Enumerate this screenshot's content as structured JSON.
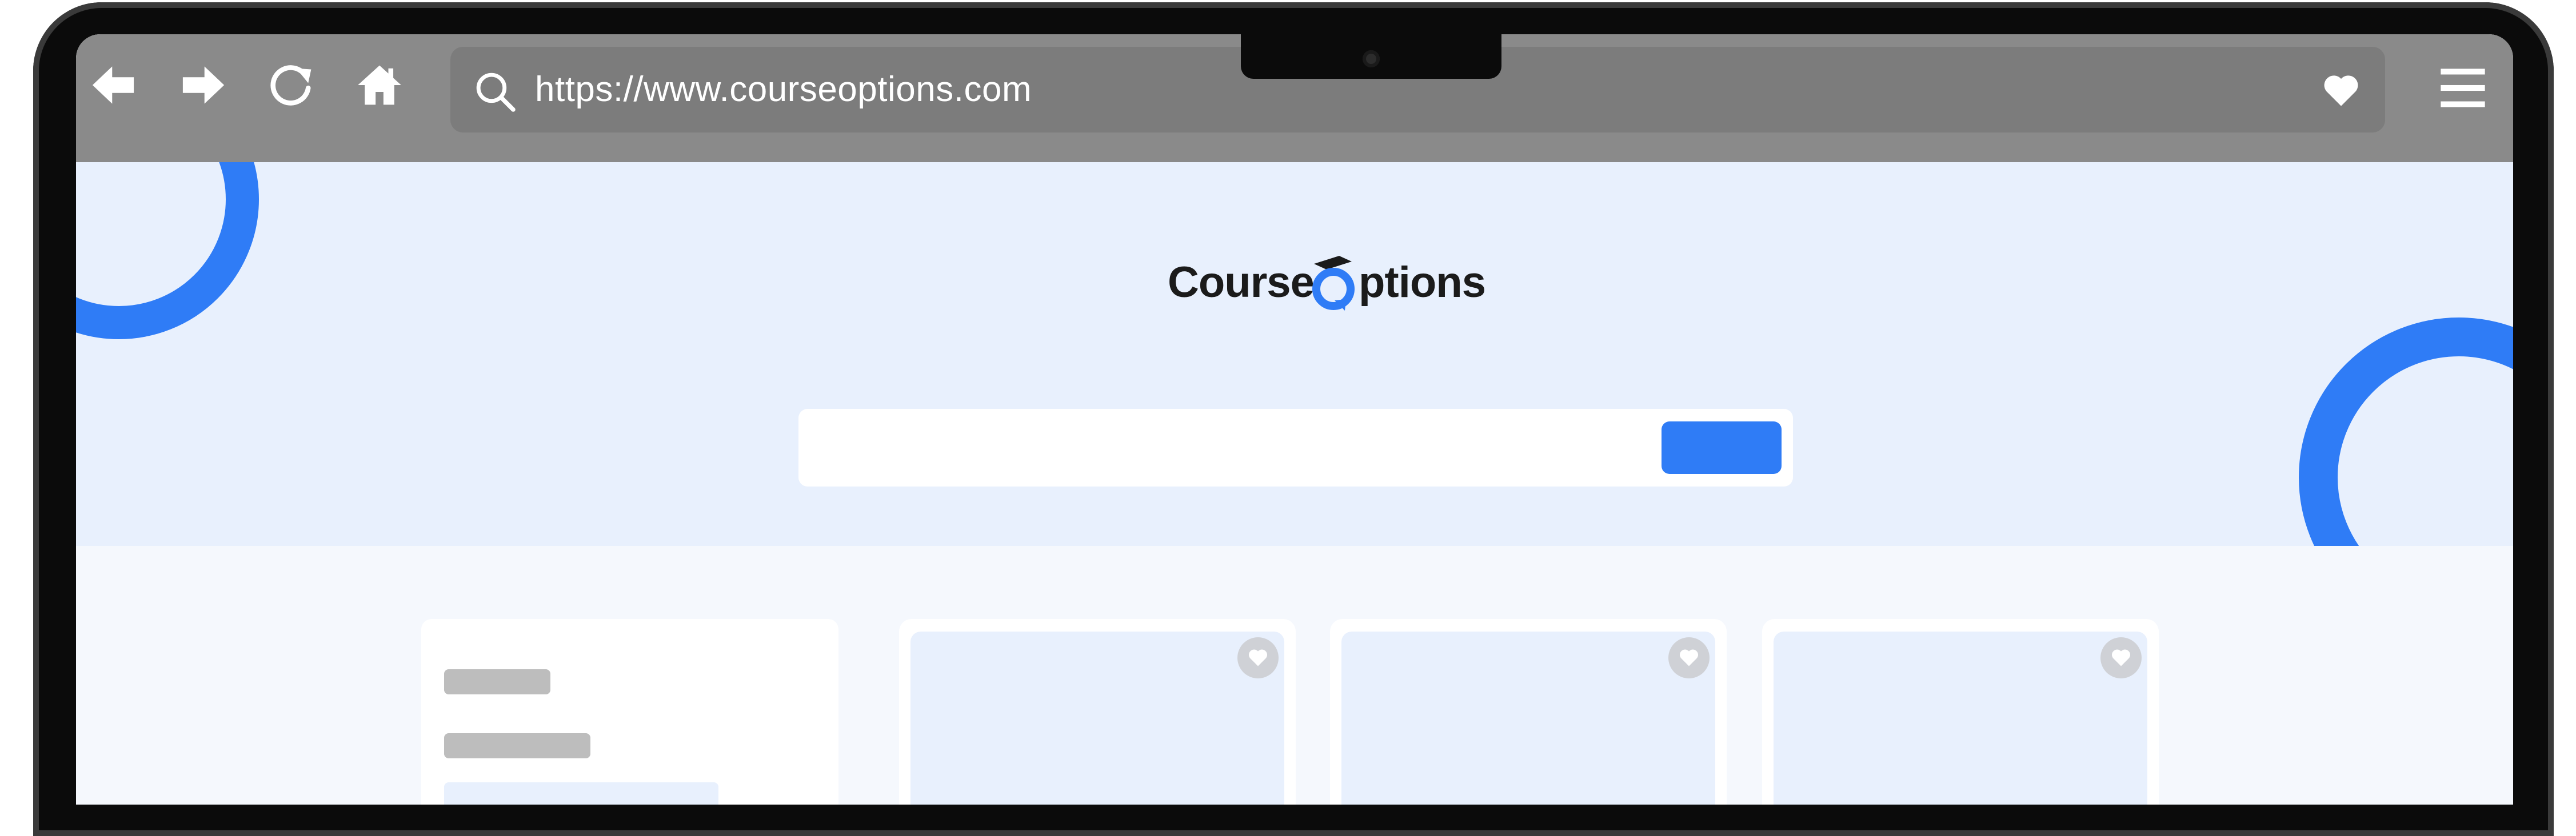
{
  "browser": {
    "url": "https://www.courseoptions.com",
    "icons": [
      "back-arrow-icon",
      "forward-arrow-icon",
      "reload-icon",
      "home-icon",
      "search-icon",
      "heart-icon",
      "menu-icon"
    ]
  },
  "site": {
    "logo_part1": "Course",
    "logo_part2": "ptions",
    "search_button_label": "",
    "search_placeholder": ""
  },
  "colors": {
    "accent": "#2f7cf6",
    "hero_bg": "#e8f0fd",
    "chrome_bg": "#8a8a8a",
    "urlbar_bg": "#7c7c7c"
  },
  "cards": [
    {
      "favorite_icon": "heart-icon"
    },
    {
      "favorite_icon": "heart-icon"
    },
    {
      "favorite_icon": "heart-icon"
    }
  ]
}
